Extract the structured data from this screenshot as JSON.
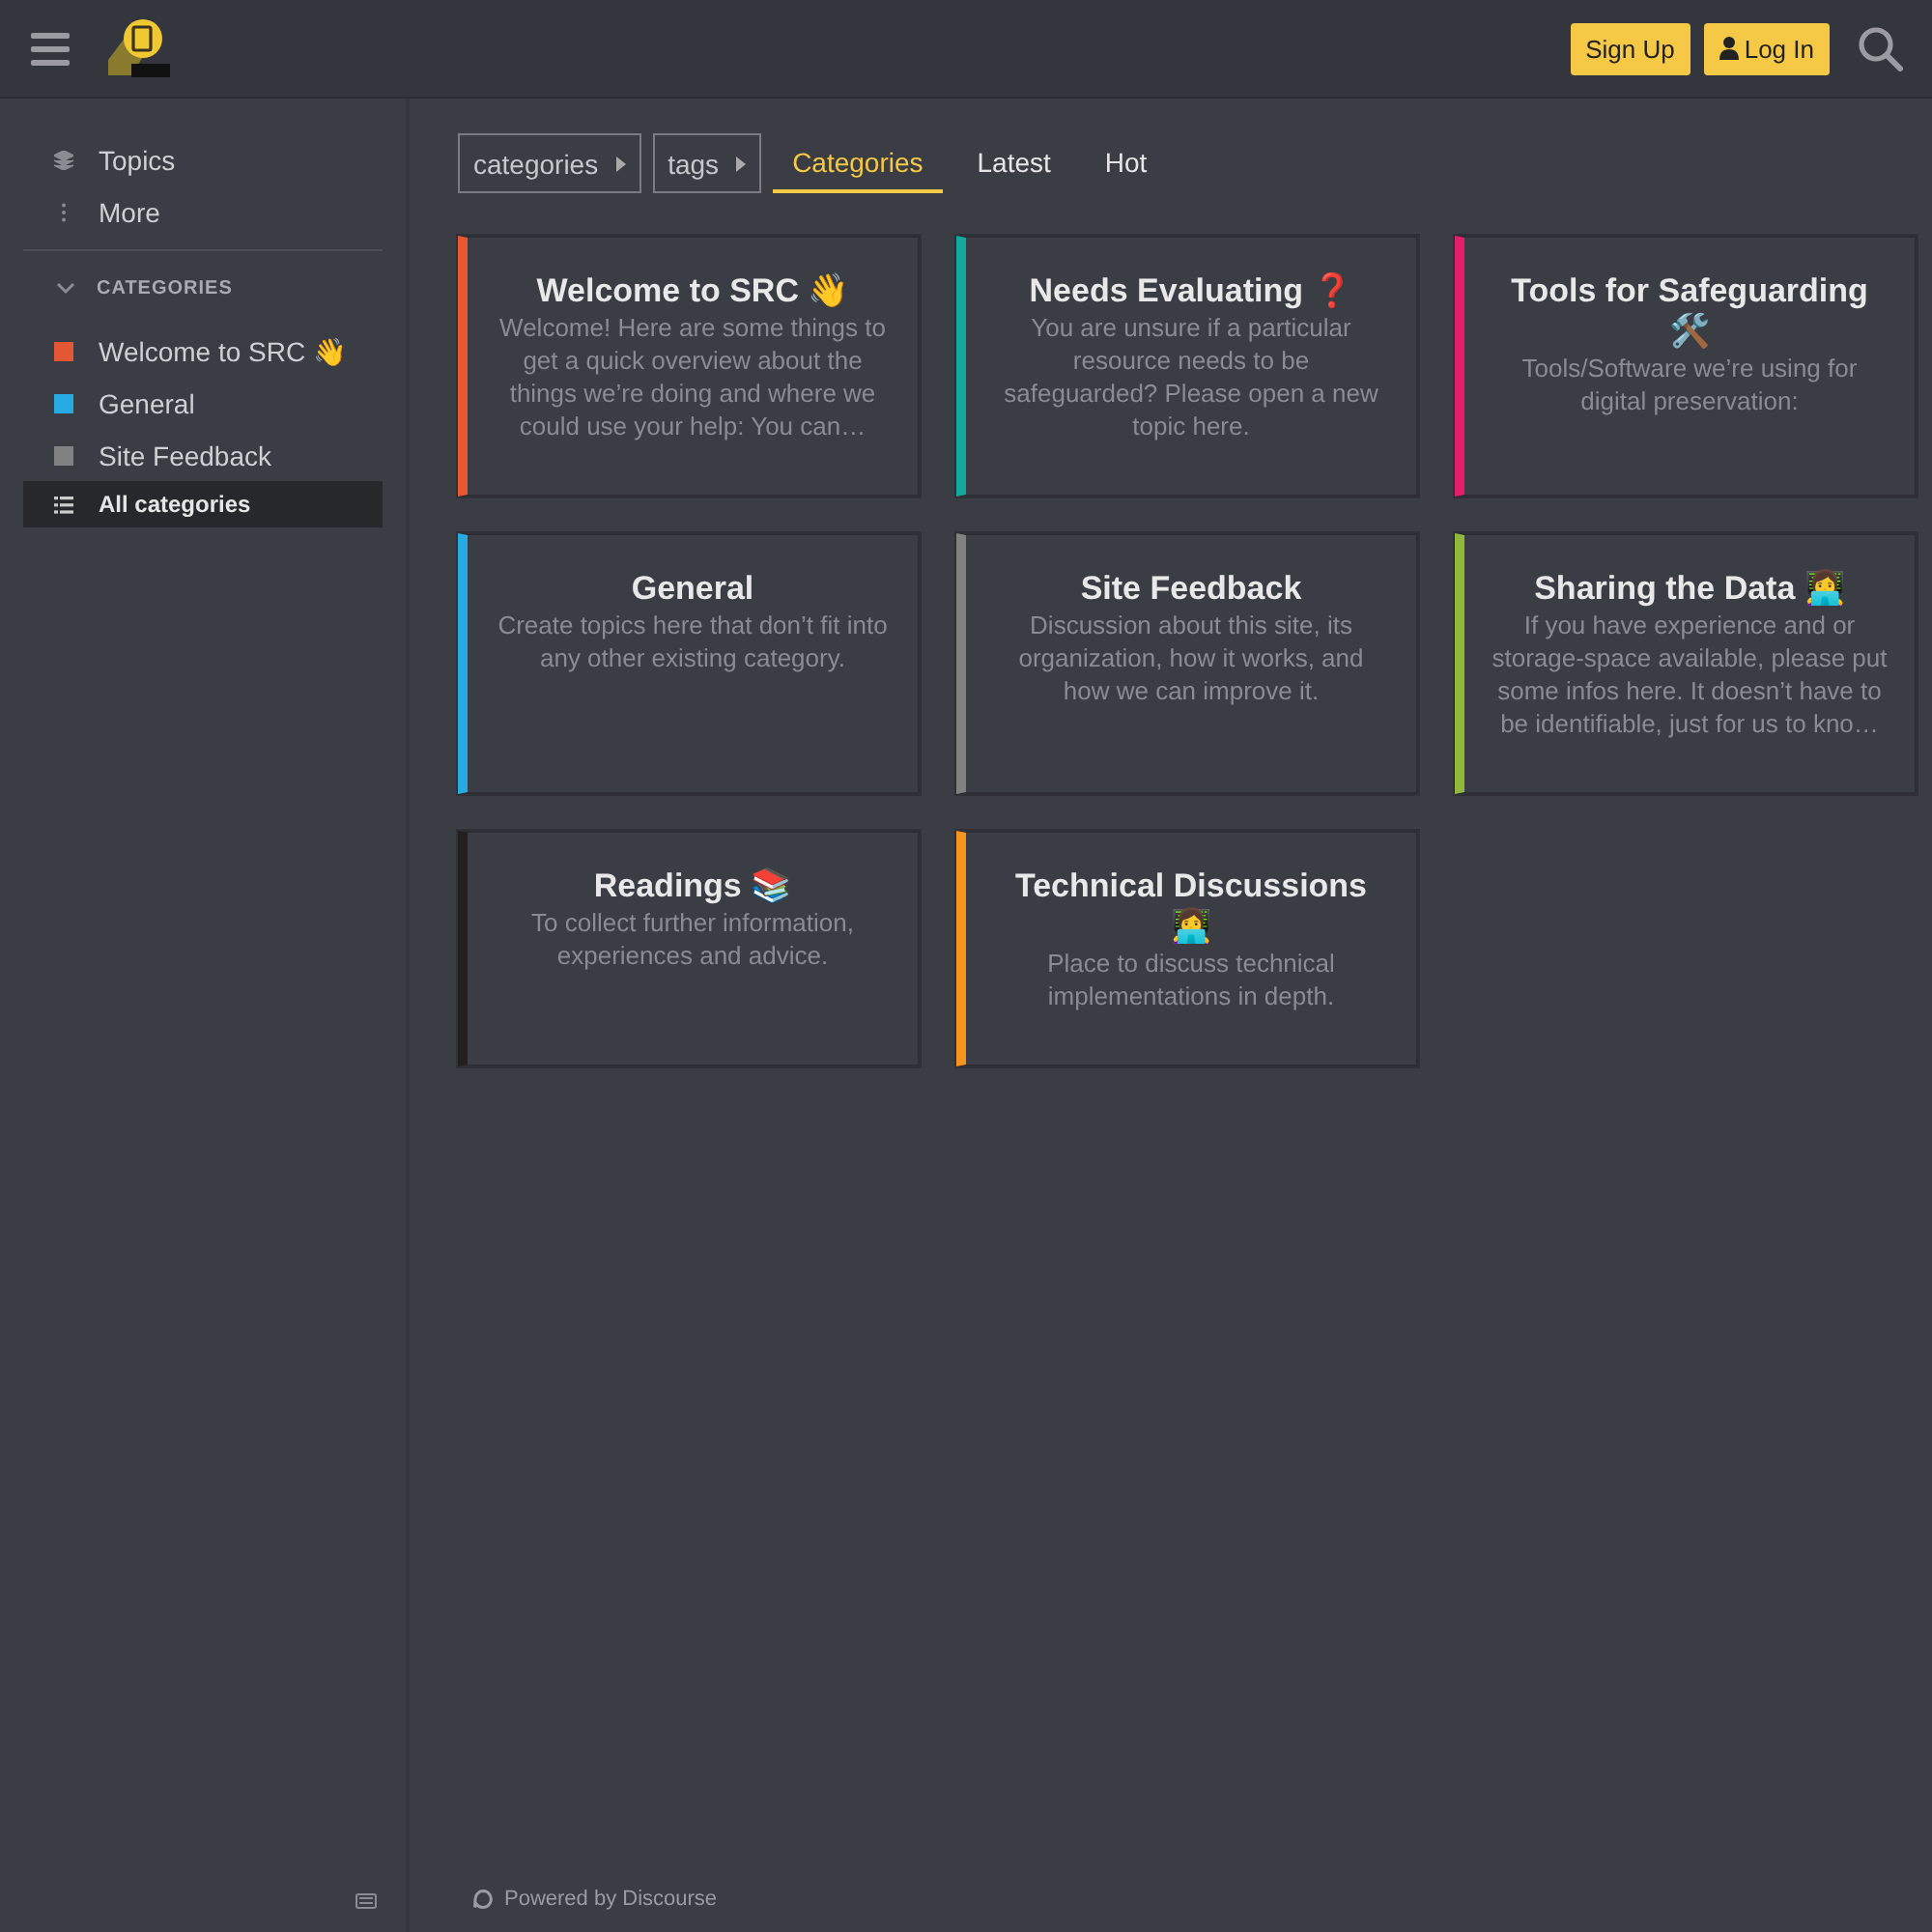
{
  "header": {
    "buttons": [
      {
        "label": "Sign Up",
        "kind": "plain"
      },
      {
        "label": "Log In",
        "kind": "user"
      }
    ]
  },
  "sidebar": {
    "links": [
      {
        "label": "Topics",
        "kind": "topics"
      },
      {
        "label": "More",
        "kind": "more"
      }
    ],
    "section": {
      "title": "CATEGORIES",
      "expanded": true,
      "items": [
        {
          "label": "Welcome to SRC 👋",
          "kind": "category",
          "color": "#e45735",
          "selected": false
        },
        {
          "label": "General",
          "kind": "category",
          "color": "#25aae1",
          "selected": false
        },
        {
          "label": "Site Feedback",
          "kind": "category",
          "color": "#808281",
          "selected": false
        },
        {
          "label": "All categories",
          "kind": "all",
          "selected": true
        }
      ]
    }
  },
  "nav": {
    "crumbs": [
      {
        "label": "categories"
      },
      {
        "label": "tags"
      }
    ],
    "tabs": [
      {
        "label": "Categories",
        "selected": true
      },
      {
        "label": "Latest",
        "selected": false
      },
      {
        "label": "Hot",
        "selected": false
      }
    ]
  },
  "categories": [
    {
      "title": "Welcome to SRC 👋",
      "description": "Welcome! Here are some things to get a quick overview about the things we’re doing and where we could use your help: You can…",
      "color": "#e9562f"
    },
    {
      "title": "Needs Evaluating ❓",
      "description": "You are unsure if a particular resource needs to be safeguarded? Please open a new topic here.",
      "color": "#12a89d"
    },
    {
      "title": "Tools for Safeguarding 🛠️",
      "description": "Tools/Software we’re using for digital preservation:",
      "color": "#e51e6a"
    },
    {
      "title": "General",
      "description": "Create topics here that don’t fit into any other existing category.",
      "color": "#25aae1"
    },
    {
      "title": "Site Feedback",
      "description": "Discussion about this site, its organization, how it works, and how we can improve it.",
      "color": "#808281"
    },
    {
      "title": "Sharing the Data 👩‍💻",
      "description": "If you have experience and or storage-space available, please put some infos here. It doesn’t have to be identifiable, just for us to kno…",
      "color": "#92b83b"
    },
    {
      "title": "Readings 📚",
      "description": "To collect further information, experiences and advice.",
      "color": "#231f20"
    },
    {
      "title": "Technical Discussions 👩‍💻",
      "description": "Place to discuss technical implementations in depth.",
      "color": "#f7941d"
    }
  ],
  "footer": {
    "label": "Powered by Discourse"
  }
}
